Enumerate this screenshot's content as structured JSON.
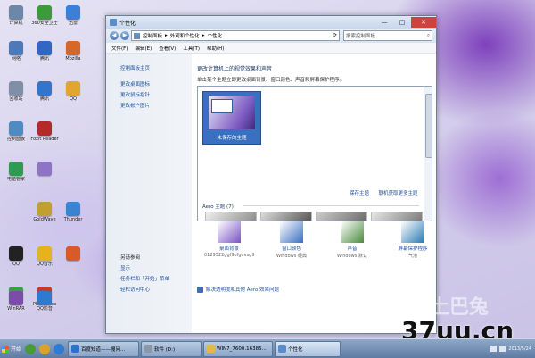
{
  "desktop_icons": [
    {
      "label": "计算机",
      "color": "#6e87a8"
    },
    {
      "label": "360安全卫士",
      "color": "#3c9a3c"
    },
    {
      "label": "迅雷",
      "color": "#3b7fd6"
    },
    {
      "label": "网络",
      "color": "#4d79b8"
    },
    {
      "label": "腾讯",
      "color": "#2f67c3"
    },
    {
      "label": "Mozilla",
      "color": "#d4682b"
    },
    {
      "label": "回收站",
      "color": "#7f8fa6"
    },
    {
      "label": "腾讯",
      "color": "#3474c9"
    },
    {
      "label": "QQ",
      "color": "#e1a62d"
    },
    {
      "label": "控制面板",
      "color": "#4c8cc0"
    },
    {
      "label": "Foxit Reader",
      "color": "#b22a2a"
    },
    {
      "label": "",
      "color": "#8d74c4"
    },
    {
      "label": "电脑管家",
      "color": "#2f9b52"
    },
    {
      "label": "GoldWave",
      "color": "#c2a030"
    },
    {
      "label": "Thunder",
      "color": "#3a83d4"
    },
    {
      "label": "QQ",
      "color": "#222222"
    },
    {
      "label": "QQ音乐",
      "color": "#e4b31e"
    },
    {
      "label": "",
      "color": "#d85a2a"
    },
    {
      "label": "360",
      "color": "#3b9f48"
    },
    {
      "label": "Photoshop",
      "color": "#c23b2b"
    },
    {
      "label": "WinRAR",
      "color": "#7a4ea6"
    },
    {
      "label": "QQ影音",
      "color": "#2d7ad0"
    }
  ],
  "window": {
    "title": "个性化",
    "min": "—",
    "max": "□",
    "close": "✕",
    "breadcrumb": [
      "控制面板",
      "外观和个性化",
      "个性化"
    ],
    "search_placeholder": "搜索控制面板",
    "menu": [
      "文件(F)",
      "编辑(E)",
      "查看(V)",
      "工具(T)",
      "帮助(H)"
    ]
  },
  "left_pane": {
    "home": "控制面板主页",
    "links": [
      "更改桌面图标",
      "更改鼠标指针",
      "更改帐户图片"
    ],
    "see_also_title": "另请参阅",
    "see_also": [
      "显示",
      "任务栏和「开始」菜单",
      "轻松访问中心"
    ]
  },
  "main": {
    "heading": "更改计算机上的视觉效果和声音",
    "desc": "单击某个主题立即更改桌面背景、窗口颜色、声音和屏幕保护程序。",
    "selected_theme": "未保存的主题",
    "save_theme": "保存主题",
    "get_more": "联机获取更多主题",
    "aero_section": "Aero 主题 (7)",
    "bottom": [
      {
        "label": "桌面背景",
        "sub": "0129522ggf9ofgovsg9...",
        "icon": "desktop-background-icon",
        "color": "#7a52c6"
      },
      {
        "label": "窗口颜色",
        "sub": "Windows 经典",
        "icon": "window-color-icon",
        "color": "#3a6fc2"
      },
      {
        "label": "声音",
        "sub": "Windows 默认",
        "icon": "sound-icon",
        "color": "#4a8b3f"
      },
      {
        "label": "屏幕保护程序",
        "sub": "气泡",
        "icon": "screensaver-icon",
        "color": "#2a7ab0"
      }
    ],
    "aero_fix": "解决透明度和其他 Aero 效果问题"
  },
  "taskbar": {
    "start": "开始",
    "buttons": [
      "百度知道——搜问...",
      "软件 (D:)",
      "WIN7_7600.16385...",
      "个性化"
    ],
    "clock": "2013/5/24"
  },
  "watermark": {
    "main": "37uu.cn",
    "secondary": "土巴兔"
  }
}
